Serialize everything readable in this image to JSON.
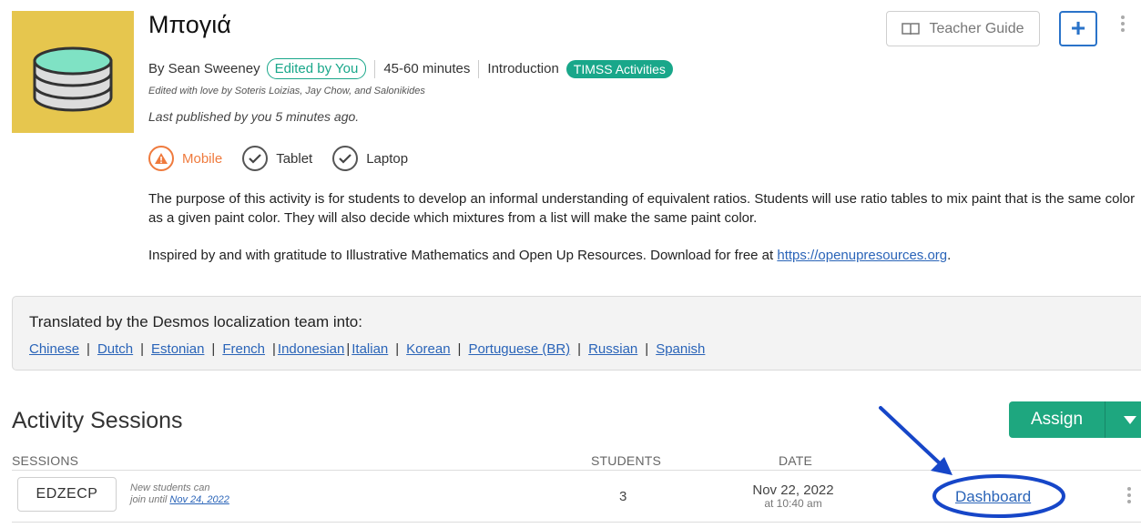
{
  "activity": {
    "title": "Μπογιά",
    "author": "By Sean Sweeney",
    "edited_badge": "Edited by You",
    "duration": "45-60 minutes",
    "section": "Introduction",
    "tag": "TIMSS Activities",
    "credits": "Edited with love by Soteris Loizias, Jay Chow, and Salonikides",
    "published": "Last published by you 5 minutes ago."
  },
  "header": {
    "teacher_guide_label": "Teacher Guide",
    "add_label": "+"
  },
  "devices": [
    {
      "label": "Mobile",
      "status": "warning",
      "icon": "warning-icon"
    },
    {
      "label": "Tablet",
      "status": "ok",
      "icon": "check-icon"
    },
    {
      "label": "Laptop",
      "status": "ok",
      "icon": "check-icon"
    }
  ],
  "description": "The purpose of this activity is for students to develop an informal understanding of equivalent ratios. Students will use ratio tables to mix paint that is the same color as a given paint color. They will also decide which mixtures from a list will make the same paint color.",
  "inspired": {
    "text": "Inspired by and with gratitude to Illustrative Mathematics and Open Up Resources. Download for free at ",
    "link": "https://openupresources.org",
    "suffix": "."
  },
  "translations": {
    "title": "Translated by the Desmos localization team into:",
    "languages": [
      "Chinese",
      "Dutch",
      "Estonian",
      "French",
      "Indonesian",
      "Italian",
      "Korean",
      "Portuguese (BR)",
      "Russian",
      "Spanish"
    ]
  },
  "sessions": {
    "title": "Activity Sessions",
    "assign_label": "Assign",
    "columns": {
      "sessions": "SESSIONS",
      "students": "STUDENTS",
      "date": "DATE"
    },
    "rows": [
      {
        "code": "EDZECP",
        "join_line1": "New students can",
        "join_line2_prefix": "join until ",
        "join_until": "Nov 24, 2022",
        "students": "3",
        "date": "Nov 22, 2022",
        "time": "at 10:40 am",
        "dashboard_label": "Dashboard"
      }
    ]
  },
  "colors": {
    "accent_teal": "#19a78a",
    "assign_green": "#1ea77f",
    "link_blue": "#2a64b8",
    "annotation_blue": "#1646c8",
    "warning_orange": "#ef7a3d",
    "thumbnail_yellow": "#e6c64e"
  }
}
